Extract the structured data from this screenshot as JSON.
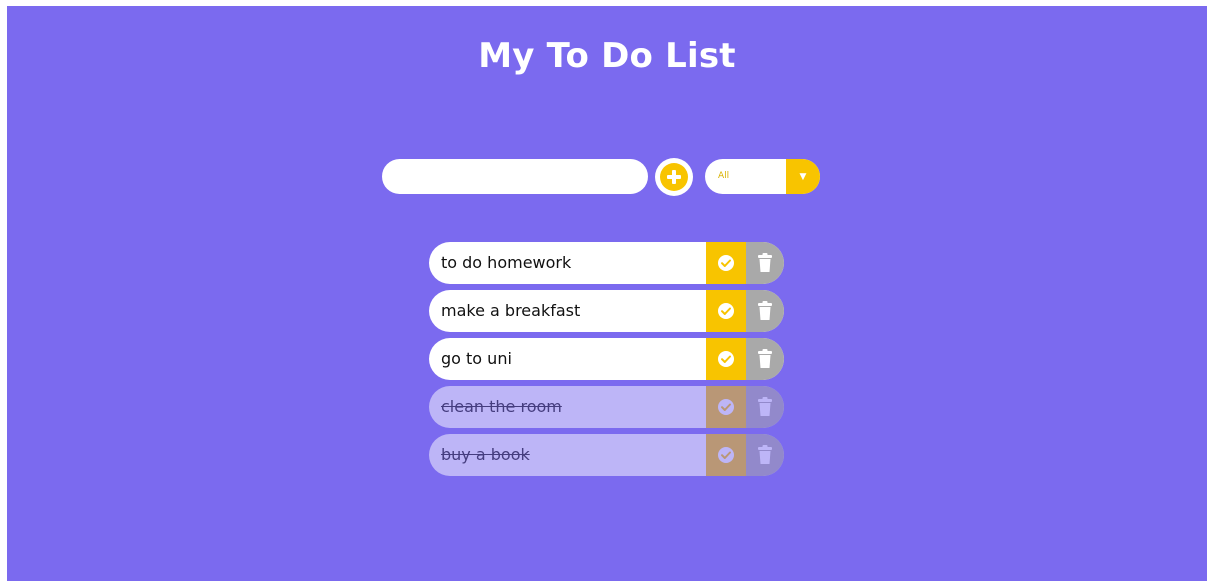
{
  "app": {
    "title": "My To Do List"
  },
  "input": {
    "value": "",
    "placeholder": ""
  },
  "filter": {
    "selected": "All",
    "arrow": "▼"
  },
  "todos": [
    {
      "text": "to do homework",
      "completed": false
    },
    {
      "text": "make a breakfast",
      "completed": false
    },
    {
      "text": "go to uni",
      "completed": false
    },
    {
      "text": "clean the room",
      "completed": true
    },
    {
      "text": "buy a book",
      "completed": true
    }
  ],
  "icons": {
    "add": "plus-circle-icon",
    "complete": "check-circle-icon",
    "delete": "trash-icon",
    "dropdown": "caret-down-icon"
  },
  "colors": {
    "background": "#7b6aef",
    "accent": "#f8c400",
    "delete": "#a9a9a9",
    "item": "#ffffff"
  }
}
